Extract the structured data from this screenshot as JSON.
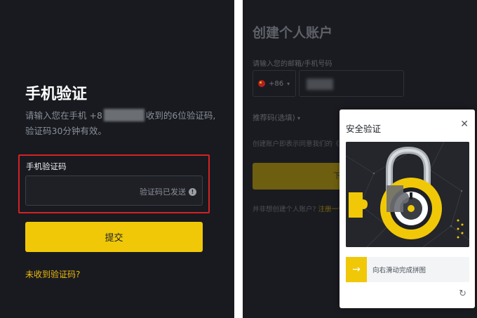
{
  "phone_verify": {
    "title": "手机验证",
    "desc_part1": "请输入您在手机 +8",
    "desc_part2": "收到的6位验证码,",
    "desc_line2": "验证码30分钟有效。",
    "field_label": "手机验证码",
    "code_status": "验证码已发送",
    "submit_label": "提交",
    "no_code_link": "未收到验证码?"
  },
  "create_account": {
    "title": "创建个人账户",
    "email_phone_label": "请输入您的邮箱/手机号码",
    "country_code": "+86",
    "referral_label": "推荐码(选填)",
    "terms_text": "创建账户即表示同意我们的《服",
    "next_label": "下一步",
    "bottom_text": "并非想创建个人账户?",
    "bottom_link": "注册一个企"
  },
  "security_modal": {
    "title": "安全验证",
    "slider_text": "向右滑动完成拼图"
  },
  "colors": {
    "accent": "#f0c808",
    "link": "#f0b90b",
    "highlight": "#d42222",
    "panel_bg": "#181a20"
  },
  "icons": [
    "info-icon",
    "chevron-down-icon",
    "close-icon",
    "arrow-right-icon",
    "refresh-icon",
    "china-flag-icon"
  ]
}
